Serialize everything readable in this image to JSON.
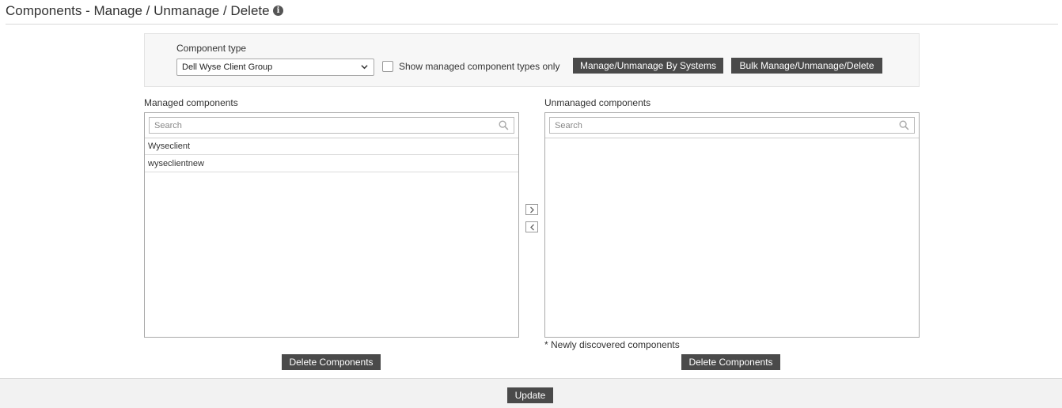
{
  "header": {
    "title": "Components - Manage / Unmanage / Delete",
    "info_icon": "info-icon"
  },
  "component_type": {
    "label": "Component type",
    "selected": "Dell Wyse Client Group",
    "show_managed_only_label": "Show managed component types only",
    "show_managed_only_checked": false,
    "manage_by_systems_label": "Manage/Unmanage By Systems",
    "bulk_label": "Bulk Manage/Unmanage/Delete"
  },
  "managed": {
    "label": "Managed components",
    "search_placeholder": "Search",
    "items": [
      "Wyseclient",
      "wyseclientnew"
    ],
    "delete_label": "Delete Components"
  },
  "unmanaged": {
    "label": "Unmanaged components",
    "search_placeholder": "Search",
    "items": [],
    "footnote": "* Newly discovered components",
    "delete_label": "Delete Components"
  },
  "transfer": {
    "move_right_icon": "chevron-right-icon",
    "move_left_icon": "chevron-left-icon"
  },
  "footer": {
    "update_label": "Update"
  },
  "colors": {
    "button_bg": "#4a4a4a",
    "panel_bg": "#f7f7f7",
    "footer_bg": "#f2f2f2"
  }
}
